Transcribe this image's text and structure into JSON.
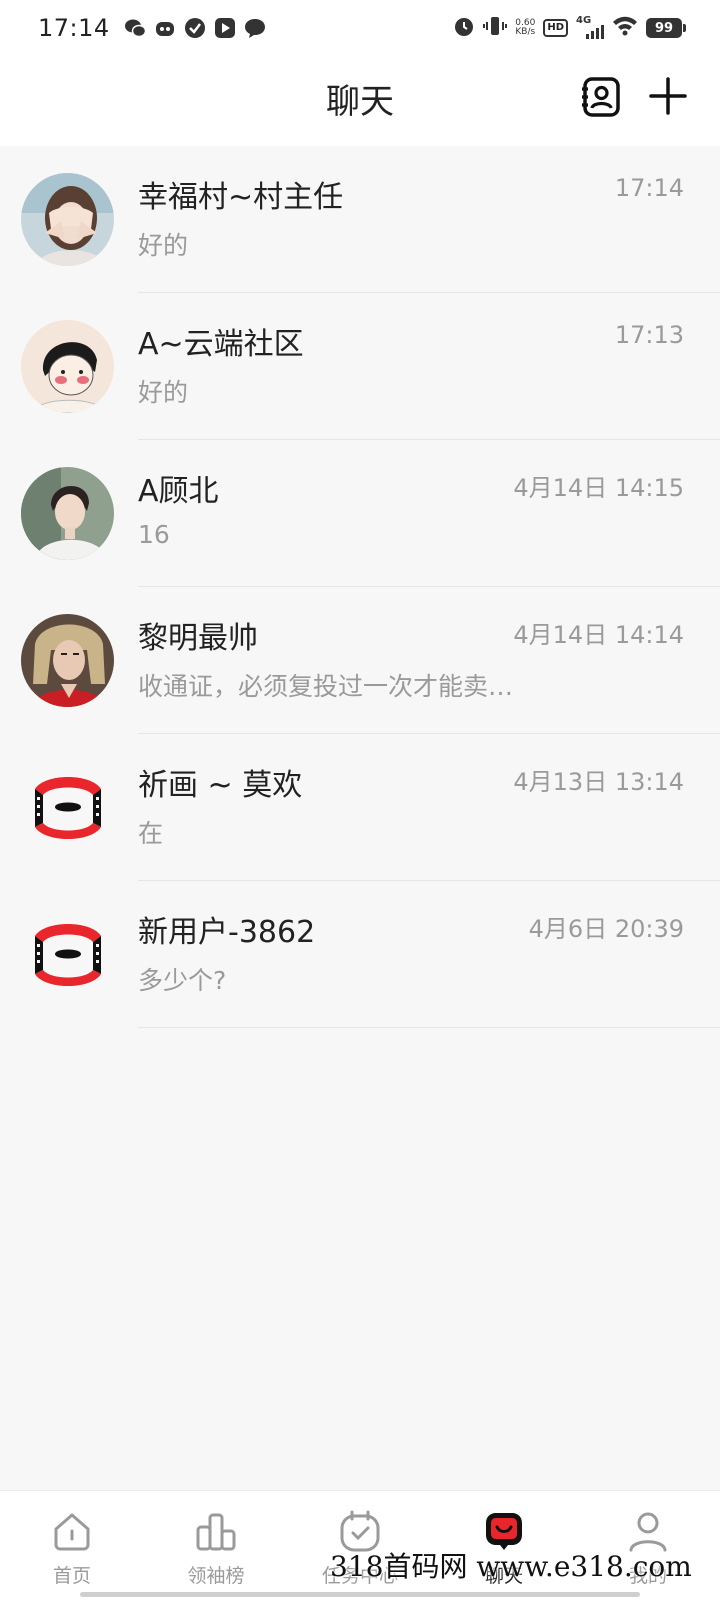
{
  "status_bar": {
    "time": "17:14",
    "net_speed_value": "0.60",
    "net_speed_unit": "KB/s",
    "hd": "HD",
    "network": "4G",
    "battery": "99",
    "notification_icons": [
      "wechat-icon",
      "app-icon",
      "check-icon",
      "play-icon",
      "message-icon"
    ]
  },
  "header": {
    "title": "聊天"
  },
  "chats": [
    {
      "name": "幸福村~村主任",
      "time": "17:14",
      "message": "好的",
      "avatar": "photo-girl"
    },
    {
      "name": "A~云端社区",
      "time": "17:13",
      "message": "好的",
      "avatar": "cartoon-boy"
    },
    {
      "name": "A顾北",
      "time": "4月14日 14:15",
      "message": "16",
      "avatar": "photo-man"
    },
    {
      "name": "黎明最帅",
      "time": "4月14日 14:14",
      "message": "收通证，必须复投过一次才能卖…",
      "avatar": "photo-man-red"
    },
    {
      "name": "祈画 ~ 莫欢",
      "time": "4月13日 13:14",
      "message": "在",
      "avatar": "film-logo"
    },
    {
      "name": "新用户-3862",
      "time": "4月6日 20:39",
      "message": "多少个?",
      "avatar": "film-logo"
    }
  ],
  "tabs": [
    {
      "label": "首页",
      "icon": "home-icon",
      "active": false
    },
    {
      "label": "领袖榜",
      "icon": "ranking-icon",
      "active": false
    },
    {
      "label": "任务中心",
      "icon": "task-icon",
      "active": false
    },
    {
      "label": "聊天",
      "icon": "chat-icon",
      "active": true
    },
    {
      "label": "我的",
      "icon": "profile-icon",
      "active": false
    }
  ],
  "watermark": "318首码网 www.e318.com",
  "colors": {
    "accent": "#e8262b",
    "background": "#f7f7f7",
    "text_secondary": "#9a9a9a"
  }
}
